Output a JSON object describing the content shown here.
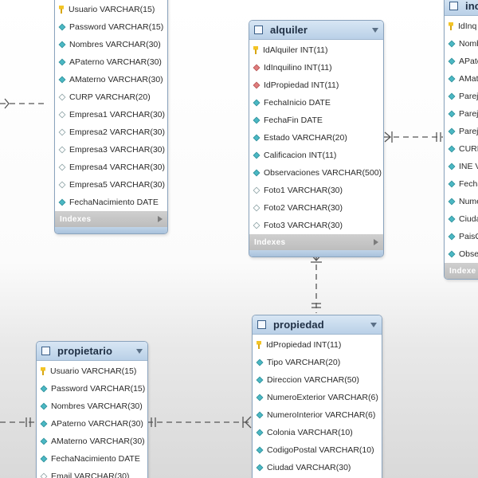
{
  "diagram": {
    "tables": {
      "usuario": {
        "name": "",
        "indexes_label": "Indexes",
        "columns": [
          {
            "text": "Usuario VARCHAR(15)",
            "icon": "key-icon"
          },
          {
            "text": "Password VARCHAR(15)",
            "icon": "diamond-cyan"
          },
          {
            "text": "Nombres VARCHAR(30)",
            "icon": "diamond-cyan"
          },
          {
            "text": "APaterno VARCHAR(30)",
            "icon": "diamond-cyan"
          },
          {
            "text": "AMaterno VARCHAR(30)",
            "icon": "diamond-cyan"
          },
          {
            "text": "CURP VARCHAR(20)",
            "icon": "diamond-open"
          },
          {
            "text": "Empresa1 VARCHAR(30)",
            "icon": "diamond-open"
          },
          {
            "text": "Empresa2 VARCHAR(30)",
            "icon": "diamond-open"
          },
          {
            "text": "Empresa3 VARCHAR(30)",
            "icon": "diamond-open"
          },
          {
            "text": "Empresa4 VARCHAR(30)",
            "icon": "diamond-open"
          },
          {
            "text": "Empresa5 VARCHAR(30)",
            "icon": "diamond-open"
          },
          {
            "text": "FechaNacimiento DATE",
            "icon": "diamond-cyan"
          }
        ]
      },
      "alquiler": {
        "name": "alquiler",
        "indexes_label": "Indexes",
        "columns": [
          {
            "text": "IdAlquiler INT(11)",
            "icon": "key-icon"
          },
          {
            "text": "IdInquilino INT(11)",
            "icon": "diamond-red"
          },
          {
            "text": "IdPropiedad INT(11)",
            "icon": "diamond-red"
          },
          {
            "text": "FechaInicio DATE",
            "icon": "diamond-cyan"
          },
          {
            "text": "FechaFin DATE",
            "icon": "diamond-cyan"
          },
          {
            "text": "Estado VARCHAR(20)",
            "icon": "diamond-cyan"
          },
          {
            "text": "Calificacion INT(11)",
            "icon": "diamond-cyan"
          },
          {
            "text": "Observaciones VARCHAR(500)",
            "icon": "diamond-cyan"
          },
          {
            "text": "Foto1 VARCHAR(30)",
            "icon": "diamond-open"
          },
          {
            "text": "Foto2 VARCHAR(30)",
            "icon": "diamond-open"
          },
          {
            "text": "Foto3 VARCHAR(30)",
            "icon": "diamond-open"
          }
        ]
      },
      "inquilino": {
        "name": "inc",
        "indexes_label": "Indexe",
        "columns": [
          {
            "text": "IdInq",
            "icon": "key-icon"
          },
          {
            "text": "Nomb",
            "icon": "diamond-cyan"
          },
          {
            "text": "APate",
            "icon": "diamond-cyan"
          },
          {
            "text": "AMat",
            "icon": "diamond-cyan"
          },
          {
            "text": "Parej",
            "icon": "diamond-cyan"
          },
          {
            "text": "Parej",
            "icon": "diamond-cyan"
          },
          {
            "text": "Parej",
            "icon": "diamond-cyan"
          },
          {
            "text": "CURP",
            "icon": "diamond-cyan"
          },
          {
            "text": "INE V",
            "icon": "diamond-cyan"
          },
          {
            "text": "Fecha",
            "icon": "diamond-cyan"
          },
          {
            "text": "Nume",
            "icon": "diamond-cyan"
          },
          {
            "text": "Ciuda",
            "icon": "diamond-cyan"
          },
          {
            "text": "PaisO",
            "icon": "diamond-cyan"
          },
          {
            "text": "Obse",
            "icon": "diamond-cyan"
          }
        ]
      },
      "propiedad": {
        "name": "propiedad",
        "columns": [
          {
            "text": "IdPropiedad INT(11)",
            "icon": "key-icon"
          },
          {
            "text": "Tipo VARCHAR(20)",
            "icon": "diamond-cyan"
          },
          {
            "text": "Direccion VARCHAR(50)",
            "icon": "diamond-cyan"
          },
          {
            "text": "NumeroExterior VARCHAR(6)",
            "icon": "diamond-cyan"
          },
          {
            "text": "NumeroInterior VARCHAR(6)",
            "icon": "diamond-cyan"
          },
          {
            "text": "Colonia VARCHAR(10)",
            "icon": "diamond-cyan"
          },
          {
            "text": "CodigoPostal VARCHAR(10)",
            "icon": "diamond-cyan"
          },
          {
            "text": "Ciudad VARCHAR(30)",
            "icon": "diamond-cyan"
          }
        ]
      },
      "propietario": {
        "name": "propietario",
        "columns": [
          {
            "text": "Usuario VARCHAR(15)",
            "icon": "key-icon"
          },
          {
            "text": "Password VARCHAR(15)",
            "icon": "diamond-cyan"
          },
          {
            "text": "Nombres VARCHAR(30)",
            "icon": "diamond-cyan"
          },
          {
            "text": "APaterno VARCHAR(30)",
            "icon": "diamond-cyan"
          },
          {
            "text": "AMaterno VARCHAR(30)",
            "icon": "diamond-cyan"
          },
          {
            "text": "FechaNacimiento DATE",
            "icon": "diamond-cyan"
          },
          {
            "text": "Email VARCHAR(30)",
            "icon": "diamond-open"
          }
        ]
      }
    },
    "colors": {
      "header_top": "#d8e6f4",
      "header_bottom": "#b9d0e7",
      "border": "#8aa3bd",
      "indexes_bg": "#c8c8c8",
      "relationship_line": "#555555"
    }
  }
}
